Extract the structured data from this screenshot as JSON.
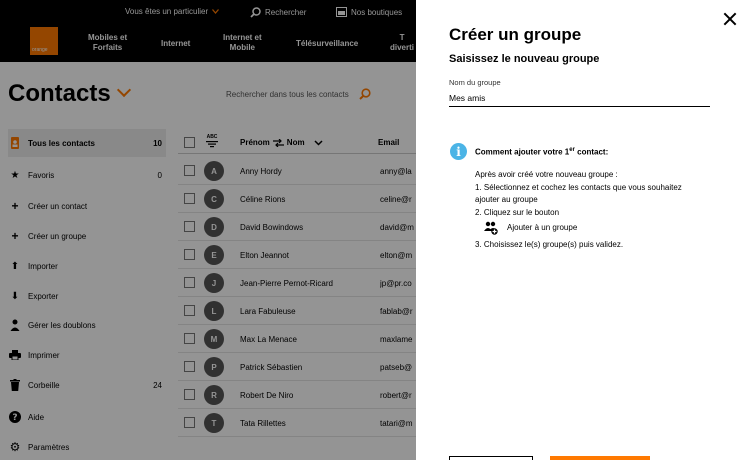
{
  "topbar": {
    "particulier_label": "Vous êtes un particulier",
    "search_label": "Rechercher",
    "shops_label": "Nos boutiques"
  },
  "brand": {
    "logo_text": "orange",
    "accent_color": "#ff7900"
  },
  "nav": {
    "items": [
      {
        "label": "Mobiles et\nForfaits"
      },
      {
        "label": "Internet"
      },
      {
        "label": "Internet et\nMobile"
      },
      {
        "label": "Télésurveillance"
      },
      {
        "label": "T\ndiverti"
      }
    ]
  },
  "contacts": {
    "title": "Contacts",
    "search_placeholder": "Rechercher dans tous les contacts"
  },
  "sidebar": {
    "items": [
      {
        "label": "Tous les contacts",
        "count": "10",
        "icon": "contacts-book-icon",
        "active": true
      },
      {
        "label": "Favoris",
        "count": "0",
        "icon": "star-icon"
      },
      {
        "label": "Créer un contact",
        "count": "",
        "icon": "plus-icon"
      },
      {
        "label": "Créer un groupe",
        "count": "",
        "icon": "plus-icon"
      },
      {
        "label": "Importer",
        "count": "",
        "icon": "arrow-up-icon"
      },
      {
        "label": "Exporter",
        "count": "",
        "icon": "arrow-down-icon"
      },
      {
        "label": "Gérer les doublons",
        "count": "",
        "icon": "person-icon"
      },
      {
        "label": "Imprimer",
        "count": "",
        "icon": "printer-icon"
      },
      {
        "label": "Corbeille",
        "count": "24",
        "icon": "trash-icon"
      },
      {
        "label": "Aide",
        "count": "",
        "icon": "help-icon"
      },
      {
        "label": "Paramètres",
        "count": "",
        "icon": "gear-icon"
      }
    ]
  },
  "table": {
    "sort_icon_label": "ABC",
    "col_prenom": "Prénom",
    "col_nom": "Nom",
    "col_email": "Email",
    "rows": [
      {
        "initial": "A",
        "name": "Anny Hordy",
        "email": "anny@la"
      },
      {
        "initial": "C",
        "name": "Céline Rions",
        "email": "celine@r"
      },
      {
        "initial": "D",
        "name": "David Bowindows",
        "email": "david@m"
      },
      {
        "initial": "E",
        "name": "Elton Jeannot",
        "email": "elton@m"
      },
      {
        "initial": "J",
        "name": "Jean-Pierre Pernot-Ricard",
        "email": "jp@pr.co"
      },
      {
        "initial": "L",
        "name": "Lara Fabuleuse",
        "email": "fablab@r"
      },
      {
        "initial": "M",
        "name": "Max La Menace",
        "email": "maxlame"
      },
      {
        "initial": "P",
        "name": "Patrick Sébastien",
        "email": "patseb@"
      },
      {
        "initial": "R",
        "name": "Robert De Niro",
        "email": "robert@r"
      },
      {
        "initial": "T",
        "name": "Tata Rillettes",
        "email": "tatari@m"
      }
    ]
  },
  "modal": {
    "title": "Créer un groupe",
    "subtitle": "Saisissez le nouveau groupe",
    "field_label": "Nom du groupe",
    "field_value": "Mes amis",
    "how_title": "Comment ajouter votre 1",
    "how_title_sup": "er",
    "how_title_end": " contact:",
    "intro": "Après avoir créé votre nouveau groupe :",
    "step1_line1": "1. Sélectionnez et cochez les contacts que vous souhaitez",
    "step1_line2": "ajouter au groupe",
    "step2": "2. Cliquez sur le bouton",
    "add_button_ref": "Ajouter à un groupe",
    "step3": "3. Choisissez le(s) groupe(s) puis validez."
  }
}
